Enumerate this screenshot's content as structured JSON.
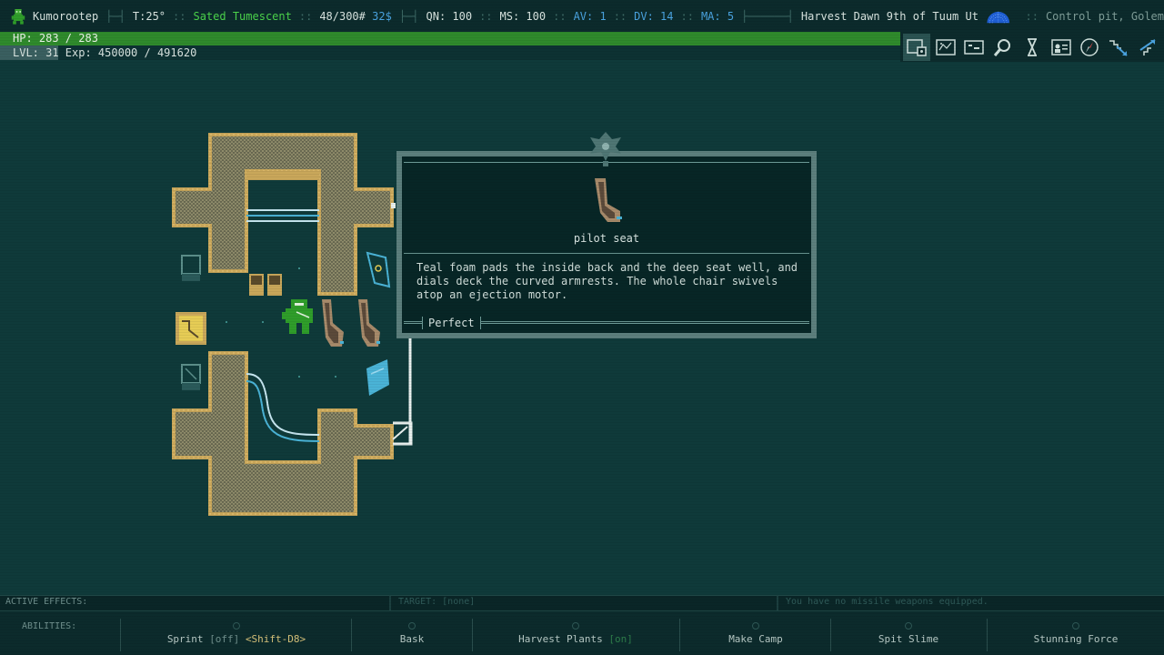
{
  "status": {
    "name": "Kumorootep",
    "temperature": "T:25°",
    "hunger": "Sated",
    "condition": "Tumescent",
    "weight": "48/300#",
    "money": "32$",
    "qn": "QN: 100",
    "ms": "MS: 100",
    "av": "AV: 1",
    "dv": "DV: 14",
    "ma": "MA: 5",
    "date": "Harvest Dawn 9th of Tuum Ut",
    "location": "Control pit, Golem"
  },
  "hp": {
    "text": "HP: 283 / 283"
  },
  "exp": {
    "text": "LVL: 31 Exp: 450000 / 491620",
    "current": 450000,
    "max": 491620
  },
  "toolbar": [
    {
      "name": "equipment-icon",
      "active": true
    },
    {
      "name": "map-icon",
      "active": false
    },
    {
      "name": "message-log-icon",
      "active": false
    },
    {
      "name": "look-icon",
      "active": false
    },
    {
      "name": "wait-icon",
      "active": false
    },
    {
      "name": "character-icon",
      "active": false
    },
    {
      "name": "compass-icon",
      "active": false
    },
    {
      "name": "descend-icon",
      "active": false
    },
    {
      "name": "ascend-icon",
      "active": false
    }
  ],
  "popup": {
    "item_name": "pilot seat",
    "description": "Teal foam pads the inside back and the deep seat well, and\ndials deck the curved armrests. The whole chair swivels\natop an ejection motor.",
    "quality": "Perfect"
  },
  "panels": {
    "effects": "ACTIVE EFFECTS:",
    "target": "TARGET: [none]",
    "missile": "You have no missile weapons equipped."
  },
  "abilities": {
    "label": "ABILITIES:",
    "sprint": {
      "name": "Sprint",
      "state": "[off]",
      "key": "<Shift-D8>"
    },
    "bask": {
      "name": "Bask"
    },
    "harvest": {
      "name": "Harvest Plants",
      "state": "[on]"
    },
    "camp": {
      "name": "Make Camp"
    },
    "spit": {
      "name": "Spit Slime"
    },
    "stun": {
      "name": "Stunning Force"
    }
  },
  "colors": {
    "background": "#0f3a3a",
    "hp_green": "#2f8a2c",
    "wall_gold": "#c9a75a",
    "player_green": "#2f9d2a",
    "teal_accent": "#4ab3d6"
  }
}
